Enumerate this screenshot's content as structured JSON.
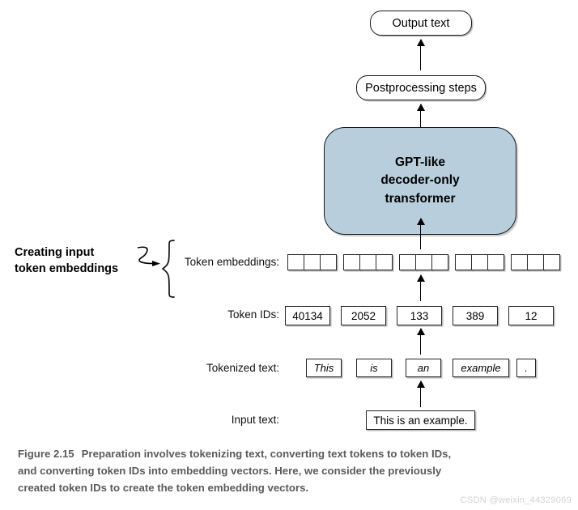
{
  "figure": {
    "output_text": "Output text",
    "postprocessing": "Postprocessing steps",
    "transformer_line1": "GPT-like",
    "transformer_line2": "decoder-only",
    "transformer_line3": "transformer",
    "transformer_fill": "#b8cedd",
    "annotation_line1": "Creating input",
    "annotation_line2": "token embeddings"
  },
  "rows": {
    "embeddings": {
      "label": "Token embeddings:",
      "groups": [
        {
          "cells": 3
        },
        {
          "cells": 3
        },
        {
          "cells": 3
        },
        {
          "cells": 3
        },
        {
          "cells": 3
        }
      ]
    },
    "token_ids": {
      "label": "Token IDs:",
      "values": [
        "40134",
        "2052",
        "133",
        "389",
        "12"
      ]
    },
    "tokenized": {
      "label": "Tokenized text:",
      "values": [
        "This",
        "is",
        "an",
        "example",
        "."
      ]
    },
    "input": {
      "label": "Input text:",
      "value": "This is an example."
    }
  },
  "caption": {
    "figure_number": "Figure 2.15",
    "text": "Preparation involves tokenizing text, converting text tokens to token IDs, and converting token IDs into embedding vectors. Here, we consider the previously created token IDs to create the token embedding vectors."
  },
  "watermark": "CSDN @weixin_44329069"
}
